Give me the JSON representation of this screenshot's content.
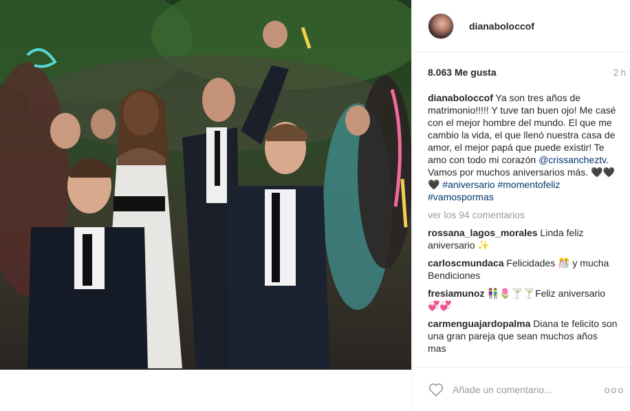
{
  "post": {
    "username": "dianaboloccof",
    "likes": "8.063 Me gusta",
    "time": "2 h",
    "caption": {
      "user": "dianaboloccof",
      "text_1": "Ya son tres años de matrimonio!!!!! Y tuve tan buen ojo! Me casé con el mejor hombre del mundo. El que me cambio la vida, el que llenó nuestra casa de amor, el mejor papá que puede existir! Te amo con todo mi corazón",
      "mention": "@crissancheztv",
      "text_2": ". Vamos por muchos aniversarios más. 🖤🖤🖤",
      "hashtag_1": "#aniversario",
      "hashtag_2": "#momentofeliz",
      "hashtag_3": "#vamospormas"
    },
    "view_all": "ver los 94 comentarios",
    "comments": [
      {
        "user": "rossana_lagos_morales",
        "text": "Linda feliz aniversario ✨"
      },
      {
        "user": "carloscmundaca",
        "text": "Felicidades 🎊 y mucha Bendiciones"
      },
      {
        "user": "fresiamunoz",
        "text": "👫🌷🍸🍸Feliz aniversario 💞💞"
      },
      {
        "user": "carmenguajardopalma",
        "text": "Diana te felicito son una gran pareja que sean muchos años mas"
      }
    ],
    "add_comment_placeholder": "Añade un comentario...",
    "more_label": "ooo"
  },
  "icons": {
    "like": "heart-outline-icon",
    "more": "more-options-icon"
  },
  "colors": {
    "link": "#003569",
    "muted": "#999999",
    "text": "#262626",
    "border": "#efefef"
  }
}
